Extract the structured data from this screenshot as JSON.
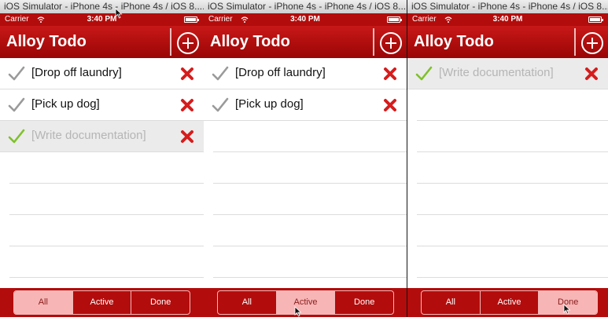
{
  "window_title": "iOS Simulator - iPhone 4s - iPhone 4s / iOS 8....",
  "status": {
    "carrier": "Carrier",
    "time": "3:40 PM"
  },
  "app": {
    "title": "Alloy Todo"
  },
  "filters": [
    "All",
    "Active",
    "Done"
  ],
  "colors": {
    "bar": "#b30c0c",
    "check_done": "#7fc12b",
    "check_gray": "#9a9a9a",
    "delete": "#d61c1c",
    "segment_selected": "#f7b5b5"
  },
  "icons": {
    "add": "plus-circle-icon",
    "check": "checkmark-icon",
    "delete": "x-icon",
    "wifi": "wifi-icon",
    "battery": "battery-icon"
  },
  "panels": [
    {
      "selected_filter": "All",
      "todos": [
        {
          "label": "[Drop off laundry]",
          "done": false
        },
        {
          "label": "[Pick up dog]",
          "done": false
        },
        {
          "label": "[Write documentation]",
          "done": true
        }
      ]
    },
    {
      "selected_filter": "Active",
      "todos": [
        {
          "label": "[Drop off laundry]",
          "done": false
        },
        {
          "label": "[Pick up dog]",
          "done": false
        }
      ]
    },
    {
      "selected_filter": "Done",
      "todos": [
        {
          "label": "[Write documentation]",
          "done": true
        }
      ]
    }
  ]
}
